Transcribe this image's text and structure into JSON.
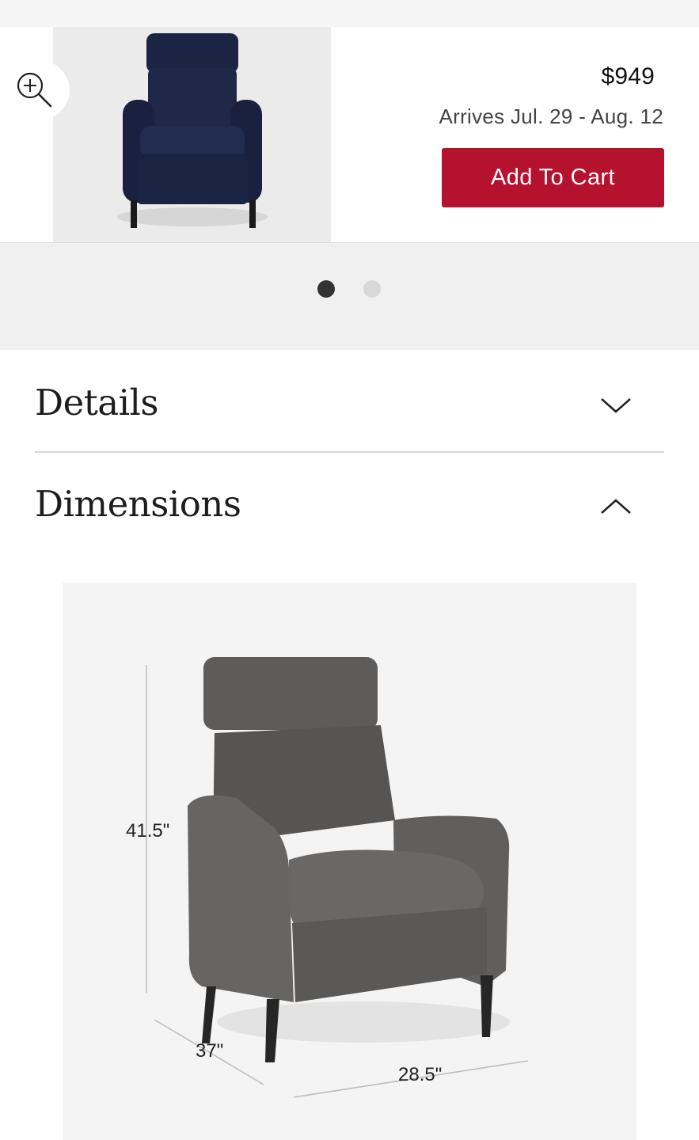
{
  "product": {
    "price": "$949",
    "arrival": "Arrives Jul. 29 - Aug. 12",
    "add_to_cart_label": "Add To Cart"
  },
  "zoom": {
    "icon": "zoom-in-icon"
  },
  "carousel": {
    "slide_count": 2,
    "active_index": 0
  },
  "accordion": {
    "details": {
      "title": "Details",
      "state": "collapsed",
      "icon": "chevron-down-icon"
    },
    "dimensions": {
      "title": "Dimensions",
      "state": "expanded",
      "icon": "chevron-up-icon"
    }
  },
  "dimensions_diagram": {
    "height": "41.5\"",
    "depth": "37\"",
    "width": "28.5\""
  },
  "colors": {
    "cart_button": "#b4122f",
    "chair_navy": "#1c2444",
    "chair_gray": "#5e5c5a"
  }
}
